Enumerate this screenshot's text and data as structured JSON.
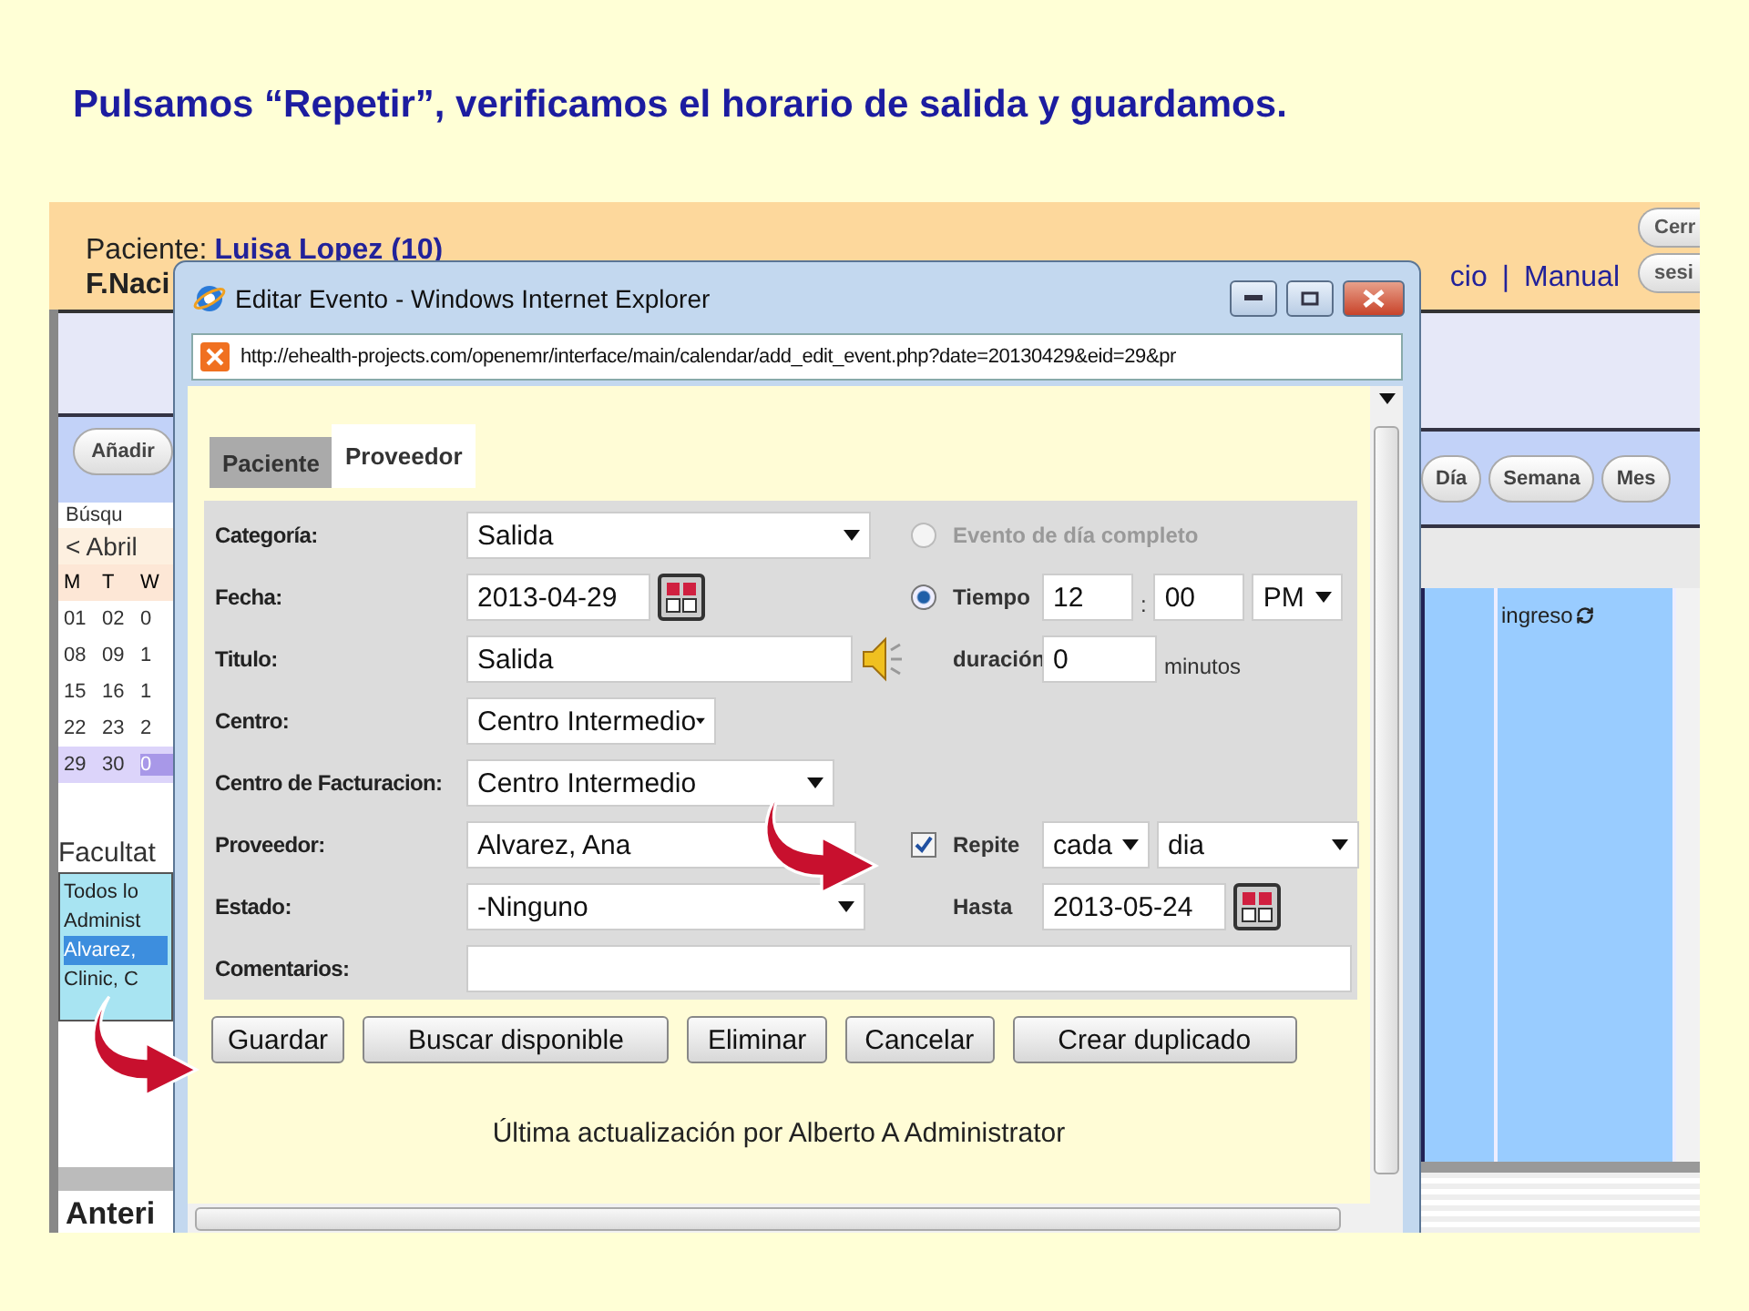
{
  "slide_title": "Pulsamos “Repetir”, verificamos el horario de salida y guardamos.",
  "app": {
    "patient_label": "Paciente:",
    "patient_name": "Luisa Lopez (10)",
    "birth_label": "F.Naci",
    "links": [
      "cio",
      "Manual"
    ],
    "link_separator": "|",
    "session_buttons": [
      "Cerr",
      "sesi"
    ],
    "add_button": "Añadir",
    "search_tab": "Búsqu",
    "calendar": {
      "nav": "< Abril",
      "weekdays": [
        "M",
        "T",
        "W"
      ],
      "weeks": [
        {
          "current": false,
          "days": [
            {
              "day": "01",
              "selected": false
            },
            {
              "day": "02",
              "selected": false
            },
            {
              "day": "0",
              "selected": false
            }
          ]
        },
        {
          "current": false,
          "days": [
            {
              "day": "08",
              "selected": false
            },
            {
              "day": "09",
              "selected": false
            },
            {
              "day": "1",
              "selected": false
            }
          ]
        },
        {
          "current": false,
          "days": [
            {
              "day": "15",
              "selected": false
            },
            {
              "day": "16",
              "selected": false
            },
            {
              "day": "1",
              "selected": false
            }
          ]
        },
        {
          "current": false,
          "days": [
            {
              "day": "22",
              "selected": false
            },
            {
              "day": "23",
              "selected": false
            },
            {
              "day": "2",
              "selected": false
            }
          ]
        },
        {
          "current": true,
          "days": [
            {
              "day": "29",
              "selected": false
            },
            {
              "day": "30",
              "selected": false
            },
            {
              "day": "0",
              "selected": true
            }
          ]
        }
      ]
    },
    "providers_label": "Facultat",
    "providers": [
      {
        "name": "Todos lo",
        "selected": false
      },
      {
        "name": "Administ",
        "selected": false
      },
      {
        "name": "Alvarez,",
        "selected": true
      },
      {
        "name": "Clinic, C",
        "selected": false
      }
    ],
    "previous": "Anteri",
    "view_buttons": [
      "Día",
      "Semana",
      "Mes"
    ],
    "column_header": "ingreso"
  },
  "popup": {
    "title": "Editar Evento - Windows Internet Explorer",
    "url": "http://ehealth-projects.com/openemr/interface/main/calendar/add_edit_event.php?date=20130429&eid=29&pr",
    "tabs": [
      {
        "label": "Paciente",
        "selected": false
      },
      {
        "label": "Proveedor",
        "selected": true
      }
    ],
    "fields": [
      {
        "label": "Categoría:",
        "kind": "select",
        "value": "Salida"
      },
      {
        "label": "Fecha:",
        "kind": "date",
        "value": "2013-04-29"
      },
      {
        "label": "Titulo:",
        "kind": "speaker",
        "value": "Salida"
      },
      {
        "label": "Centro:",
        "kind": "select",
        "value": "Centro Intermedio"
      },
      {
        "label": "Centro de Facturacion:",
        "kind": "select",
        "value": "Centro Intermedio"
      },
      {
        "label": "Proveedor:",
        "kind": "text",
        "value": "Alvarez, Ana"
      },
      {
        "label": "Estado:",
        "kind": "select",
        "value": "-Ninguno"
      },
      {
        "label": "Comentarios:",
        "kind": "wide"
      }
    ],
    "all_day": {
      "label": "Evento de día completo",
      "selected": false,
      "disabled": true
    },
    "timed": {
      "label": "Tiempo",
      "selected": true,
      "hour": "12",
      "separator": ":",
      "minute": "00",
      "meridiem": "PM"
    },
    "duration": {
      "label": "duración",
      "value": "0",
      "unit": "minutos"
    },
    "repeat": {
      "label": "Repite",
      "checked": true,
      "frequency": "cada",
      "period": "dia"
    },
    "until": {
      "label": "Hasta",
      "value": "2013-05-24"
    },
    "buttons": [
      "Guardar",
      "Buscar disponible",
      "Eliminar",
      "Cancelar",
      "Crear duplicado"
    ],
    "footer": "Última actualización por Alberto A Administrator"
  }
}
